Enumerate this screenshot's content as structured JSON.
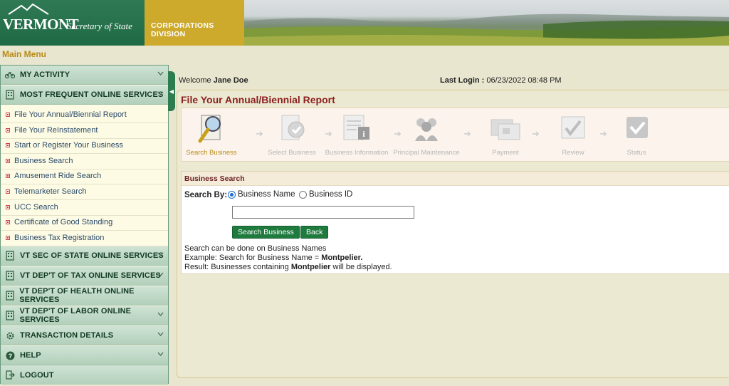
{
  "header": {
    "logo_text": "VERMONT",
    "logo_subtitle": "Secretary of State",
    "division": "CORPORATIONS DIVISION"
  },
  "main_menu": "Main Menu",
  "sidebar": {
    "sections": [
      {
        "label": "MY ACTIVITY",
        "icon": "bicycle-icon"
      },
      {
        "label": "MOST FREQUENT ONLINE SERVICES",
        "icon": "building-icon"
      }
    ],
    "items": [
      "File Your Annual/Biennial Report",
      "File Your ReInstatement",
      "Start or Register Your Business",
      "Business Search",
      "Amusement Ride Search",
      "Telemarketer Search",
      "UCC Search",
      "Certificate of Good Standing",
      "Business Tax Registration"
    ],
    "lower_sections": [
      {
        "label": "VT SEC OF STATE ONLINE SERVICES",
        "icon": "building-icon"
      },
      {
        "label": "VT DEP'T OF TAX ONLINE SERVICES",
        "icon": "building-icon"
      },
      {
        "label": "VT DEP'T OF HEALTH ONLINE SERVICES",
        "icon": "building-icon"
      },
      {
        "label": "VT DEP'T OF LABOR ONLINE SERVICES",
        "icon": "building-icon"
      },
      {
        "label": "TRANSACTION DETAILS",
        "icon": "gear-icon"
      },
      {
        "label": "HELP",
        "icon": "help-icon"
      },
      {
        "label": "LOGOUT",
        "icon": "logout-icon"
      }
    ]
  },
  "welcome": {
    "prefix": "Welcome",
    "name": "Jane Doe"
  },
  "last_login": {
    "label": "Last Login :",
    "value": "06/23/2022 08:48 PM"
  },
  "report_title": "File Your Annual/Biennial Report",
  "steps": [
    "Search Business",
    "Select Business",
    "Business Information",
    "Principal Maintenance",
    "Payment",
    "Review",
    "Status"
  ],
  "business_search": {
    "heading": "Business Search",
    "search_by": "Search By:",
    "option_name": "Business Name",
    "option_id": "Business ID",
    "input_value": "",
    "search_button": "Search Business",
    "back_button": "Back",
    "hint1": "Search can be done on Business Names",
    "hint2_prefix": "Example: Search for Business Name = ",
    "hint2_bold": "Montpelier.",
    "hint3_prefix": "Result: Businesses containing ",
    "hint3_bold": "Montpelier",
    "hint3_suffix": " will be displayed."
  },
  "colors": {
    "brand_green": "#1f6a45",
    "division_gold": "#cda92c",
    "title_red": "#8a1f1f",
    "button_green": "#1f7a3e"
  }
}
